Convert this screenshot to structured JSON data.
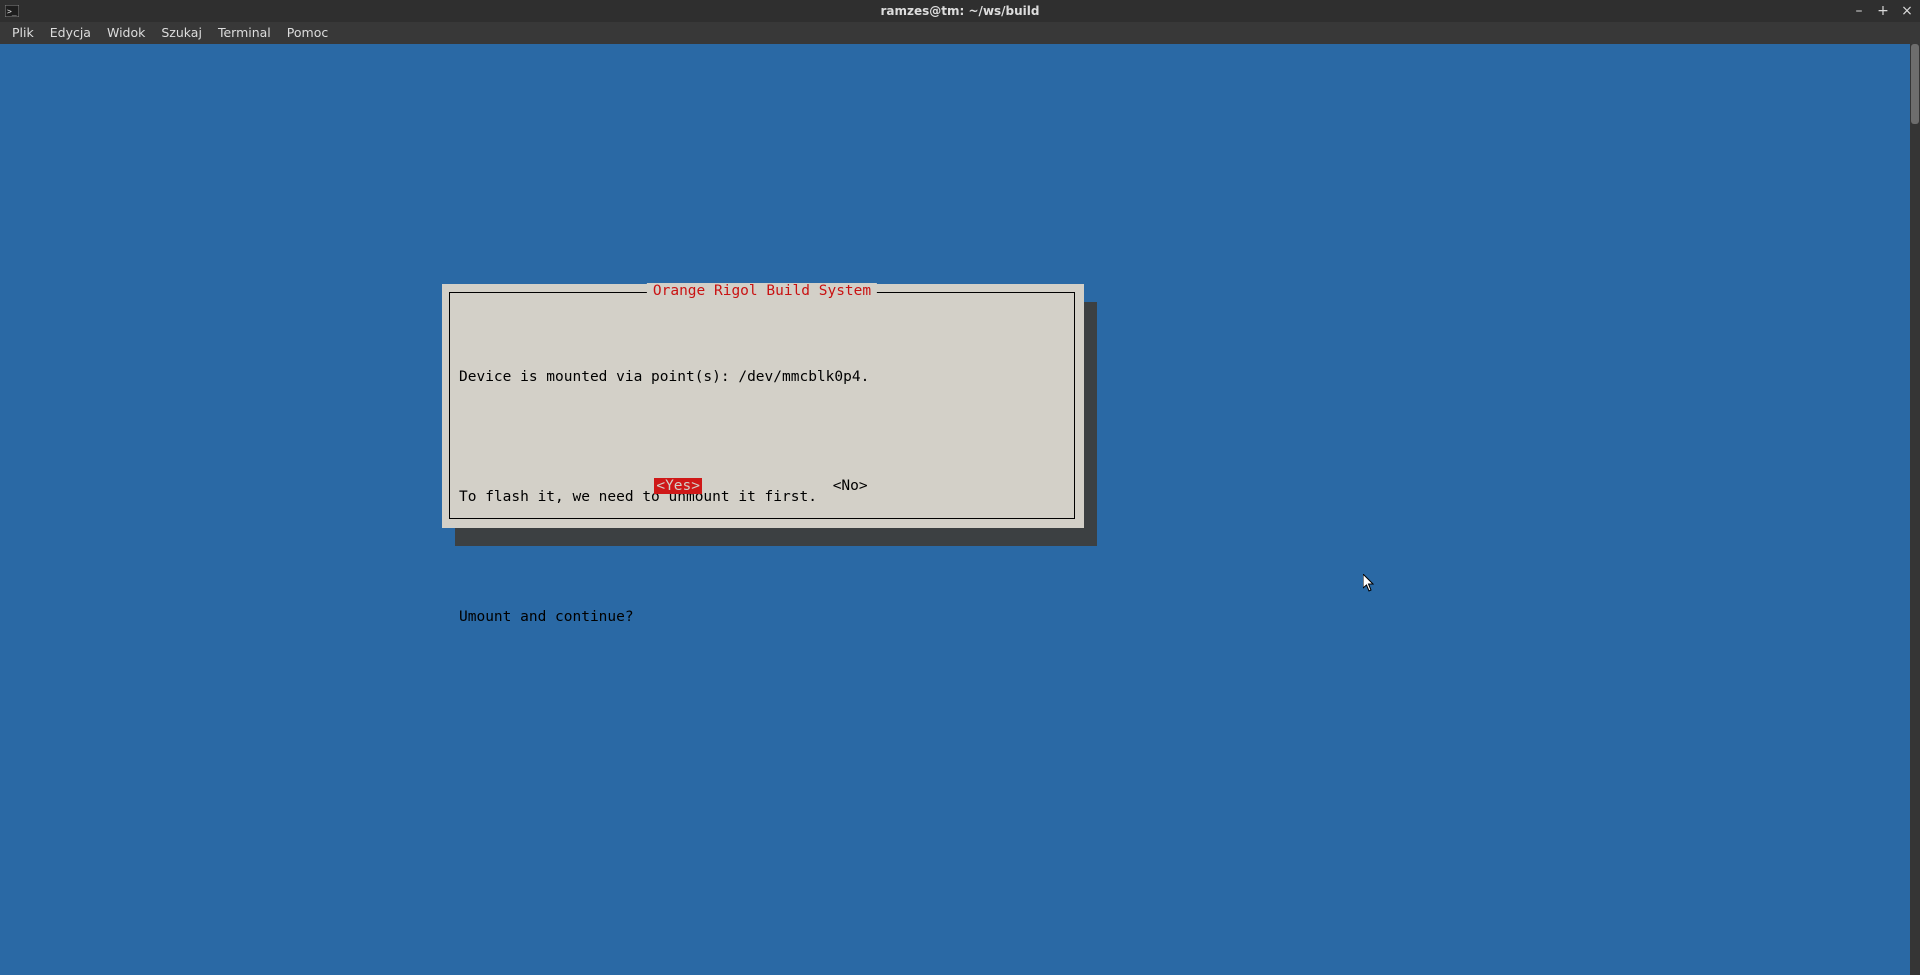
{
  "window": {
    "title": "ramzes@tm: ~/ws/build"
  },
  "menubar": {
    "items": [
      "Plik",
      "Edycja",
      "Widok",
      "Szukaj",
      "Terminal",
      "Pomoc"
    ]
  },
  "dialog": {
    "title": " Orange Rigol Build System ",
    "lines": [
      "Device is mounted via point(s): /dev/mmcblk0p4.",
      "",
      "To flash it, we need to unmount it first.",
      "",
      "Umount and continue?"
    ],
    "yes": "<Yes>",
    "no": "<No>"
  },
  "controls": {
    "minimize": "–",
    "maximize": "+",
    "close": "×"
  }
}
